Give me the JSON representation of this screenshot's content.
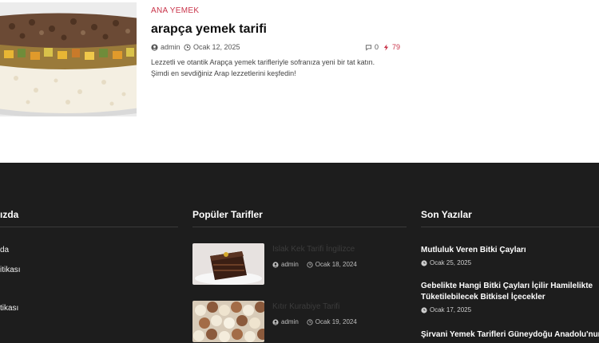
{
  "article": {
    "category": "ANA YEMEK",
    "title": "arapça yemek tarifi",
    "author": "admin",
    "date": "Ocak 12, 2025",
    "comments": "0",
    "views": "79",
    "excerpt_line1": "Lezzetli ve otantik Arapça yemek tarifleriyle sofranıza yeni bir tat katın.",
    "excerpt_line2": "Şimdi en sevdiğiniz Arap lezzetlerini keşfedin!"
  },
  "footer": {
    "col1": {
      "heading": "ızda",
      "links": [
        "da",
        "itikası",
        "tikası"
      ]
    },
    "col2": {
      "heading": "Popüler Tarifler",
      "items": [
        {
          "title": "Islak Kek Tarifi İngilizce",
          "author": "admin",
          "date": "Ocak 18, 2024"
        },
        {
          "title": "Kıtır Kurabiye Tarifi",
          "author": "admin",
          "date": "Ocak 19, 2024"
        }
      ]
    },
    "col3": {
      "heading": "Son Yazılar",
      "posts": [
        {
          "title_line1": "Mutluluk Veren Bitki Çayları",
          "title_line2": "",
          "date": "Ocak 25, 2025"
        },
        {
          "title_line1": "Gebelikte Hangi Bitki Çayları İçilir Hamilelikte",
          "title_line2": "Tüketilebilecek Bitkisel İçecekler",
          "date": "Ocak 17, 2025"
        },
        {
          "title_line1": "Şirvani Yemek Tarifleri Güneydoğu Anadolu'nun",
          "title_line2": "",
          "date": ""
        }
      ]
    }
  },
  "colors": {
    "accent": "#c9344a",
    "footer_bg": "#1d1d1d"
  },
  "icons": [
    "user-icon",
    "clock-icon",
    "comment-icon",
    "bolt-icon"
  ]
}
